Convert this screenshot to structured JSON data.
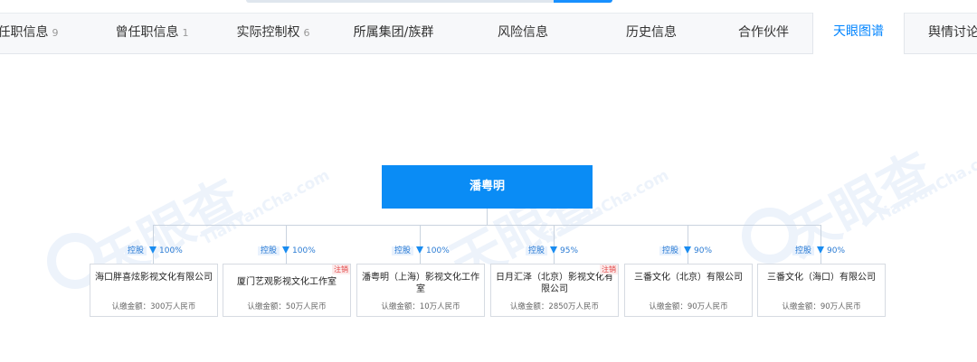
{
  "tabs": [
    {
      "label": "任职信息",
      "count": "9"
    },
    {
      "label": "曾任职信息",
      "count": "1"
    },
    {
      "label": "实际控制权",
      "count": "6"
    },
    {
      "label": "所属集团/族群",
      "count": ""
    },
    {
      "label": "风险信息",
      "count": ""
    },
    {
      "label": "历史信息",
      "count": ""
    },
    {
      "label": "合作伙伴",
      "count": ""
    },
    {
      "label": "天眼图谱",
      "count": ""
    },
    {
      "label": "舆情讨论",
      "count": ""
    }
  ],
  "watermark": {
    "text": "天眼查",
    "sub": "TianYanCha.com"
  },
  "root": {
    "name": "潘粤明"
  },
  "children": [
    {
      "relation": "控股",
      "percent": "100%",
      "name": "海口胖喜炫影视文化有限公司",
      "amount": "认缴金额：300万人民币",
      "tag": ""
    },
    {
      "relation": "控股",
      "percent": "100%",
      "name": "厦门艺观影视文化工作室",
      "amount": "认缴金额：50万人民币",
      "tag": "注销"
    },
    {
      "relation": "控股",
      "percent": "100%",
      "name": "潘粤明（上海）影视文化工作室",
      "amount": "认缴金额：10万人民币",
      "tag": ""
    },
    {
      "relation": "控股",
      "percent": "95%",
      "name": "日月汇泽（北京）影视文化有限公司",
      "amount": "认缴金额：2850万人民币",
      "tag": "注销"
    },
    {
      "relation": "控股",
      "percent": "90%",
      "name": "三番文化（北京）有限公司",
      "amount": "认缴金额：90万人民币",
      "tag": ""
    },
    {
      "relation": "控股",
      "percent": "90%",
      "name": "三番文化（海口）有限公司",
      "amount": "认缴金额：90万人民币",
      "tag": ""
    }
  ],
  "colors": {
    "accent": "#0a8cf5",
    "active_tab": "#0084ff",
    "cancel_tag": "#e04040",
    "connector": "#c9d3df"
  }
}
